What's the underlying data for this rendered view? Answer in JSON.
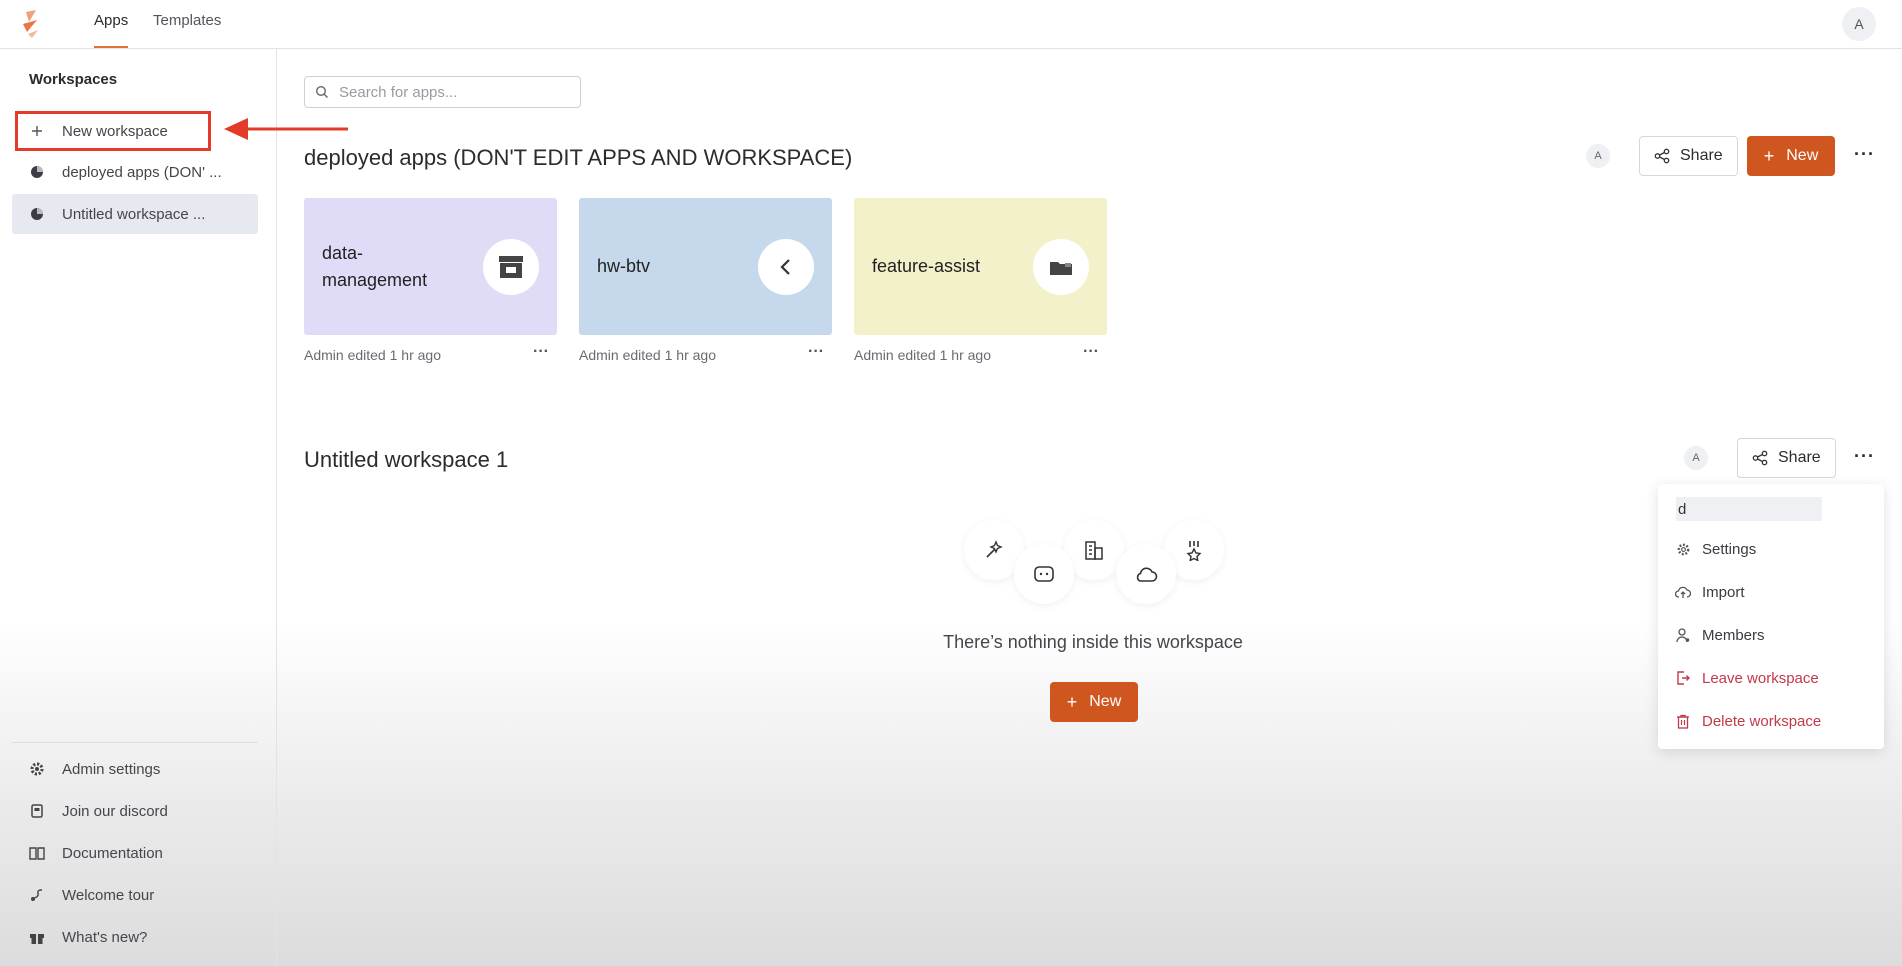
{
  "topbar": {
    "tabs": [
      {
        "label": "Apps",
        "active": true
      },
      {
        "label": "Templates",
        "active": false
      }
    ],
    "avatar_initial": "A",
    "accent_color": "#e0703f"
  },
  "sidebar": {
    "heading": "Workspaces",
    "new_workspace_label": "New workspace",
    "workspaces": [
      {
        "label": "deployed apps (DON' ...",
        "selected": false
      },
      {
        "label": "Untitled workspace ...",
        "selected": true
      }
    ],
    "footer": [
      {
        "label": "Admin settings",
        "icon": "gear-icon"
      },
      {
        "label": "Join our discord",
        "icon": "discord-icon"
      },
      {
        "label": "Documentation",
        "icon": "book-icon"
      },
      {
        "label": "Welcome tour",
        "icon": "route-icon"
      },
      {
        "label": "What's new?",
        "icon": "gift-icon"
      }
    ]
  },
  "search": {
    "placeholder": "Search for apps..."
  },
  "workspace_1": {
    "title": "deployed apps (DON'T EDIT APPS AND WORKSPACE)",
    "avatar_initial": "A",
    "share_label": "Share",
    "new_label": "New",
    "apps": [
      {
        "name_line1": "data-",
        "name_line2": "management",
        "meta": "Admin edited 1 hr ago",
        "color": "#e0dcf8",
        "icon": "storefront-icon"
      },
      {
        "name_line1": "hw-btv",
        "name_line2": "",
        "meta": "Admin edited 1 hr ago",
        "color": "#c6d8ec",
        "icon": "chevron-left-icon"
      },
      {
        "name_line1": "feature-assist",
        "name_line2": "",
        "meta": "Admin edited 1 hr ago",
        "color": "#f3f1c9",
        "icon": "folder-icon"
      }
    ]
  },
  "workspace_2": {
    "title": "Untitled workspace 1",
    "avatar_initial": "A",
    "share_label": "Share",
    "empty_text": "There’s nothing inside this workspace",
    "new_label": "New"
  },
  "menu": {
    "input_value": "d",
    "items": [
      {
        "label": "Settings",
        "icon": "gear-icon",
        "danger": false
      },
      {
        "label": "Import",
        "icon": "cloud-upload-icon",
        "danger": false
      },
      {
        "label": "Members",
        "icon": "user-icon",
        "danger": false
      },
      {
        "label": "Leave workspace",
        "icon": "exit-icon",
        "danger": true
      },
      {
        "label": "Delete workspace",
        "icon": "trash-icon",
        "danger": true
      }
    ]
  },
  "colors": {
    "primary": "#d0561f",
    "danger": "#c2394a",
    "annotation": "#e23b2a"
  }
}
